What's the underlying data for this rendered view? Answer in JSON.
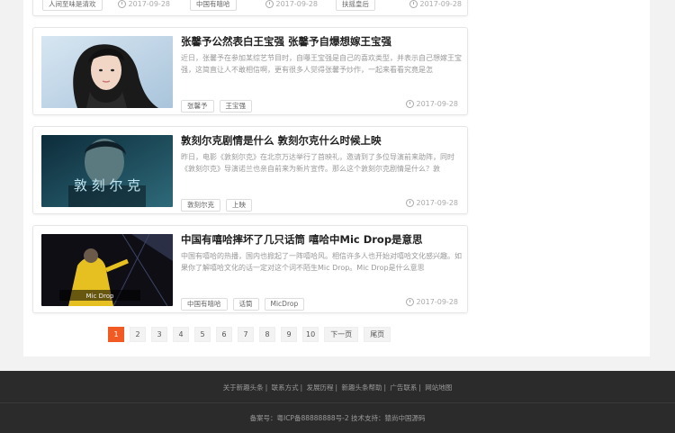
{
  "top_row": [
    {
      "tag": "人间至味是清欢",
      "date": "2017-09-28"
    },
    {
      "tag": "中国有嘻哈",
      "date": "2017-09-28"
    },
    {
      "tag": "扶摇皇后",
      "date": "2017-09-28"
    }
  ],
  "articles": [
    {
      "title": "张馨予公然表白王宝强 张馨予自爆想嫁王宝强",
      "summary": "近日，张馨予在参加某综艺节目时，自曝王宝强是自己的喜欢类型，并表示自己想嫁王宝强，这简直让人不敢相信啊，更有很多人觉得张馨予炒作，一起来看看究竟是怎",
      "tags": [
        "张馨予",
        "王宝强"
      ],
      "date": "2017-09-28",
      "image_icon": "portrait-photo"
    },
    {
      "title": "敦刻尔克剧情是什么 敦刻尔克什么时候上映",
      "summary": "昨日，电影《敦刻尔克》在北京万达举行了首映礼，邀请到了多位导演前来助阵，同时《敦刻尔克》导演诺兰也亲自前来为新片宣传。那么这个敦刻尔克剧情是什么？敦",
      "tags": [
        "敦刻尔克",
        "上映"
      ],
      "date": "2017-09-28",
      "image_text": "敦 刻 尔 克"
    },
    {
      "title": "中国有嘻哈摔坏了几只话筒 嘻哈中Mic Drop是意思",
      "summary": "中国有嘻哈的热播，国内也掀起了一阵嘻哈风。相信许多人也开始对嘻哈文化感兴趣。如果你了解嘻哈文化的话一定对这个词不陌生Mic Drop。Mic Drop是什么意思",
      "tags": [
        "中国有嘻哈",
        "话筒",
        "MicDrop"
      ],
      "date": "2017-09-28",
      "image_caption": "Mic Drop"
    }
  ],
  "pagination": {
    "pages": [
      "1",
      "2",
      "3",
      "4",
      "5",
      "6",
      "7",
      "8",
      "9",
      "10"
    ],
    "current": "1",
    "next": "下一页",
    "last": "尾页"
  },
  "footer": {
    "links": [
      "关于新趣头条",
      "联系方式",
      "发展历程",
      "新趣头条帮助",
      "广告联系",
      "网站地图"
    ],
    "copyright": "备案号：粤ICP备88888888号-2 技术支持：猿尚中国源码"
  },
  "colors": {
    "accent": "#f15a22",
    "footer_bg": "#2b2b2b"
  }
}
